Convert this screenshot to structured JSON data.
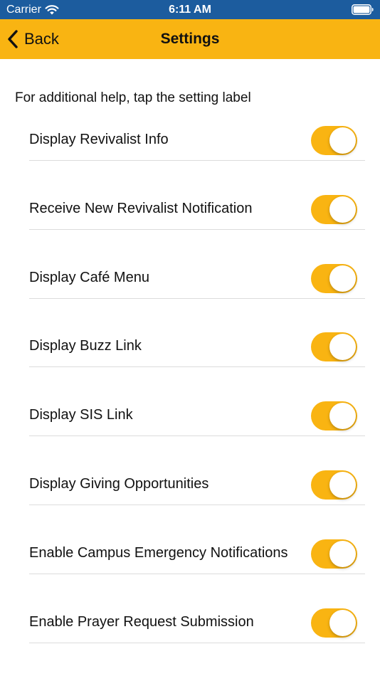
{
  "status_bar": {
    "carrier": "Carrier",
    "time": "6:11 AM",
    "background_color": "#1c5c9e"
  },
  "nav_bar": {
    "back_label": "Back",
    "title": "Settings",
    "background_color": "#f9b412"
  },
  "help_text": "For additional help, tap the setting label",
  "settings": [
    {
      "label": "Display Revivalist Info",
      "enabled": true
    },
    {
      "label": "Receive New Revivalist Notification",
      "enabled": true
    },
    {
      "label": "Display Café Menu",
      "enabled": true
    },
    {
      "label": "Display Buzz Link",
      "enabled": true
    },
    {
      "label": "Display SIS Link",
      "enabled": true
    },
    {
      "label": "Display Giving Opportunities",
      "enabled": true
    },
    {
      "label": "Enable Campus Emergency Notifications",
      "enabled": true
    },
    {
      "label": "Enable Prayer Request Submission",
      "enabled": true
    }
  ],
  "accent_color": "#f9b412"
}
